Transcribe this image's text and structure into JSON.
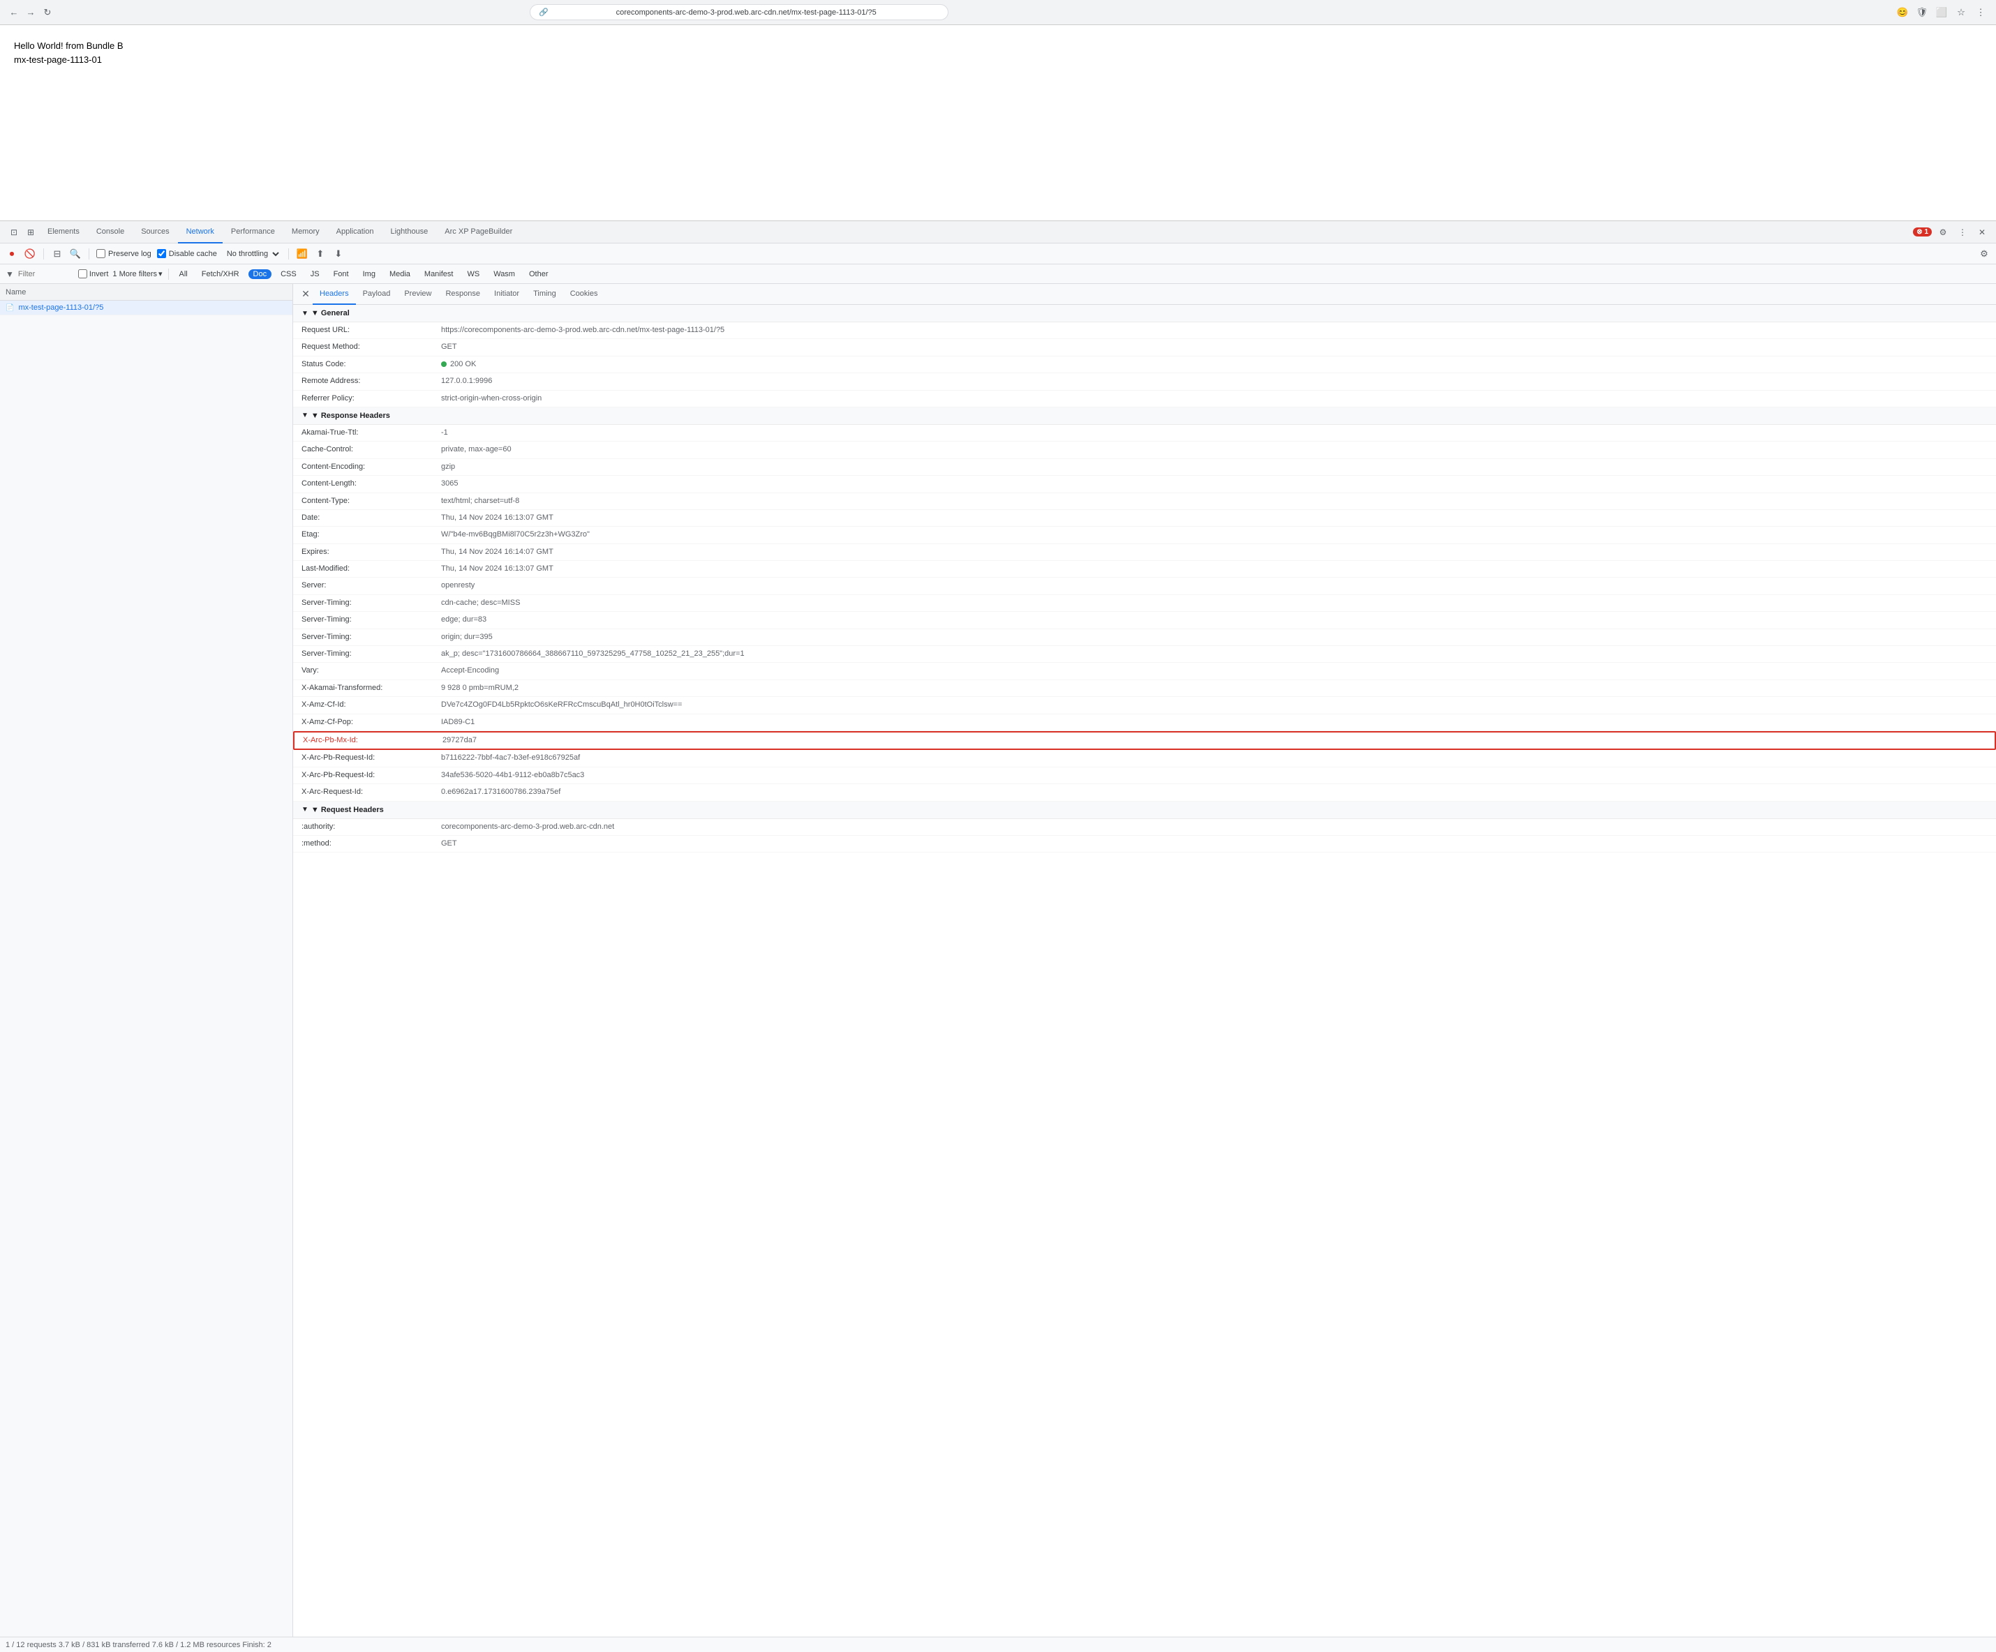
{
  "browser": {
    "url": "corecomponents-arc-demo-3-prod.web.arc-cdn.net/mx-test-page-1113-01/?5",
    "url_display": "corecomponents-arc-demo-3-prod.web.arc-cdn.net/mx-test-page-1113-01/?5"
  },
  "page": {
    "line1": "Hello World! from Bundle B",
    "line2": "mx-test-page-1113-01"
  },
  "devtools": {
    "tabs": [
      {
        "id": "elements",
        "label": "Elements"
      },
      {
        "id": "console",
        "label": "Console"
      },
      {
        "id": "sources",
        "label": "Sources"
      },
      {
        "id": "network",
        "label": "Network"
      },
      {
        "id": "performance",
        "label": "Performance"
      },
      {
        "id": "memory",
        "label": "Memory"
      },
      {
        "id": "application",
        "label": "Application"
      },
      {
        "id": "lighthouse",
        "label": "Lighthouse"
      },
      {
        "id": "arcxp",
        "label": "Arc XP PageBuilder"
      }
    ],
    "error_count": "1",
    "toolbar": {
      "preserve_log_label": "Preserve log",
      "disable_cache_label": "Disable cache",
      "throttle_value": "No throttling"
    },
    "filter": {
      "placeholder": "Filter",
      "invert_label": "Invert",
      "more_filters_label": "1  More filters",
      "chips": [
        {
          "id": "all",
          "label": "All"
        },
        {
          "id": "fetchxhr",
          "label": "Fetch/XHR"
        },
        {
          "id": "doc",
          "label": "Doc",
          "active": true
        },
        {
          "id": "css",
          "label": "CSS"
        },
        {
          "id": "js",
          "label": "JS"
        },
        {
          "id": "font",
          "label": "Font"
        },
        {
          "id": "img",
          "label": "Img"
        },
        {
          "id": "media",
          "label": "Media"
        },
        {
          "id": "manifest",
          "label": "Manifest"
        },
        {
          "id": "ws",
          "label": "WS"
        },
        {
          "id": "wasm",
          "label": "Wasm"
        },
        {
          "id": "other",
          "label": "Other"
        }
      ]
    },
    "requests_column": "Name",
    "request": {
      "name": "mx-test-page-1113-01/?5",
      "icon": "📄"
    },
    "details": {
      "tabs": [
        {
          "id": "headers",
          "label": "Headers",
          "active": true
        },
        {
          "id": "payload",
          "label": "Payload"
        },
        {
          "id": "preview",
          "label": "Preview"
        },
        {
          "id": "response",
          "label": "Response"
        },
        {
          "id": "initiator",
          "label": "Initiator"
        },
        {
          "id": "timing",
          "label": "Timing"
        },
        {
          "id": "cookies",
          "label": "Cookies"
        }
      ],
      "general": {
        "title": "▼ General",
        "fields": [
          {
            "key": "Request URL:",
            "value": "https://corecomponents-arc-demo-3-prod.web.arc-cdn.net/mx-test-page-1113-01/?5"
          },
          {
            "key": "Request Method:",
            "value": "GET"
          },
          {
            "key": "Status Code:",
            "value": "200 OK",
            "type": "status"
          },
          {
            "key": "Remote Address:",
            "value": "127.0.0.1:9996"
          },
          {
            "key": "Referrer Policy:",
            "value": "strict-origin-when-cross-origin"
          }
        ]
      },
      "response_headers": {
        "title": "▼ Response Headers",
        "fields": [
          {
            "key": "Akamai-True-Ttl:",
            "value": "-1"
          },
          {
            "key": "Cache-Control:",
            "value": "private, max-age=60"
          },
          {
            "key": "Content-Encoding:",
            "value": "gzip"
          },
          {
            "key": "Content-Length:",
            "value": "3065"
          },
          {
            "key": "Content-Type:",
            "value": "text/html; charset=utf-8"
          },
          {
            "key": "Date:",
            "value": "Thu, 14 Nov 2024 16:13:07 GMT"
          },
          {
            "key": "Etag:",
            "value": "W/\"b4e-mv6BqgBMi8l70C5r2z3h+WG3Zro\""
          },
          {
            "key": "Expires:",
            "value": "Thu, 14 Nov 2024 16:14:07 GMT"
          },
          {
            "key": "Last-Modified:",
            "value": "Thu, 14 Nov 2024 16:13:07 GMT"
          },
          {
            "key": "Server:",
            "value": "openresty"
          },
          {
            "key": "Server-Timing:",
            "value": "cdn-cache; desc=MISS"
          },
          {
            "key": "Server-Timing:",
            "value": "edge; dur=83"
          },
          {
            "key": "Server-Timing:",
            "value": "origin; dur=395"
          },
          {
            "key": "Server-Timing:",
            "value": "ak_p; desc=\"1731600786664_388667110_597325295_47758_10252_21_23_255\";dur=1"
          },
          {
            "key": "Vary:",
            "value": "Accept-Encoding"
          },
          {
            "key": "X-Akamai-Transformed:",
            "value": "9 928 0 pmb=mRUM,2"
          },
          {
            "key": "X-Amz-Cf-Id:",
            "value": "DVe7c4ZOg0FD4Lb5RpktcO6sKeRFRcCmscuBqAtl_hr0H0tOiTclsw=="
          },
          {
            "key": "X-Amz-Cf-Pop:",
            "value": "IAD89-C1"
          },
          {
            "key": "X-Arc-Pb-Mx-Id:",
            "value": "29727da7",
            "highlighted": true
          },
          {
            "key": "X-Arc-Pb-Request-Id:",
            "value": "b7116222-7bbf-4ac7-b3ef-e918c67925af"
          },
          {
            "key": "X-Arc-Pb-Request-Id:",
            "value": "34afe536-5020-44b1-9112-eb0a8b7c5ac3"
          },
          {
            "key": "X-Arc-Request-Id:",
            "value": "0.e6962a17.1731600786.239a75ef"
          }
        ]
      },
      "request_headers": {
        "title": "▼ Request Headers",
        "fields": [
          {
            "key": ":authority:",
            "value": "corecomponents-arc-demo-3-prod.web.arc-cdn.net"
          },
          {
            "key": ":method:",
            "value": "GET"
          }
        ]
      }
    }
  },
  "status_bar": {
    "text": "1 / 12 requests   3.7 kB / 831 kB transferred   7.6 kB / 1.2 MB resources   Finish: 2"
  }
}
